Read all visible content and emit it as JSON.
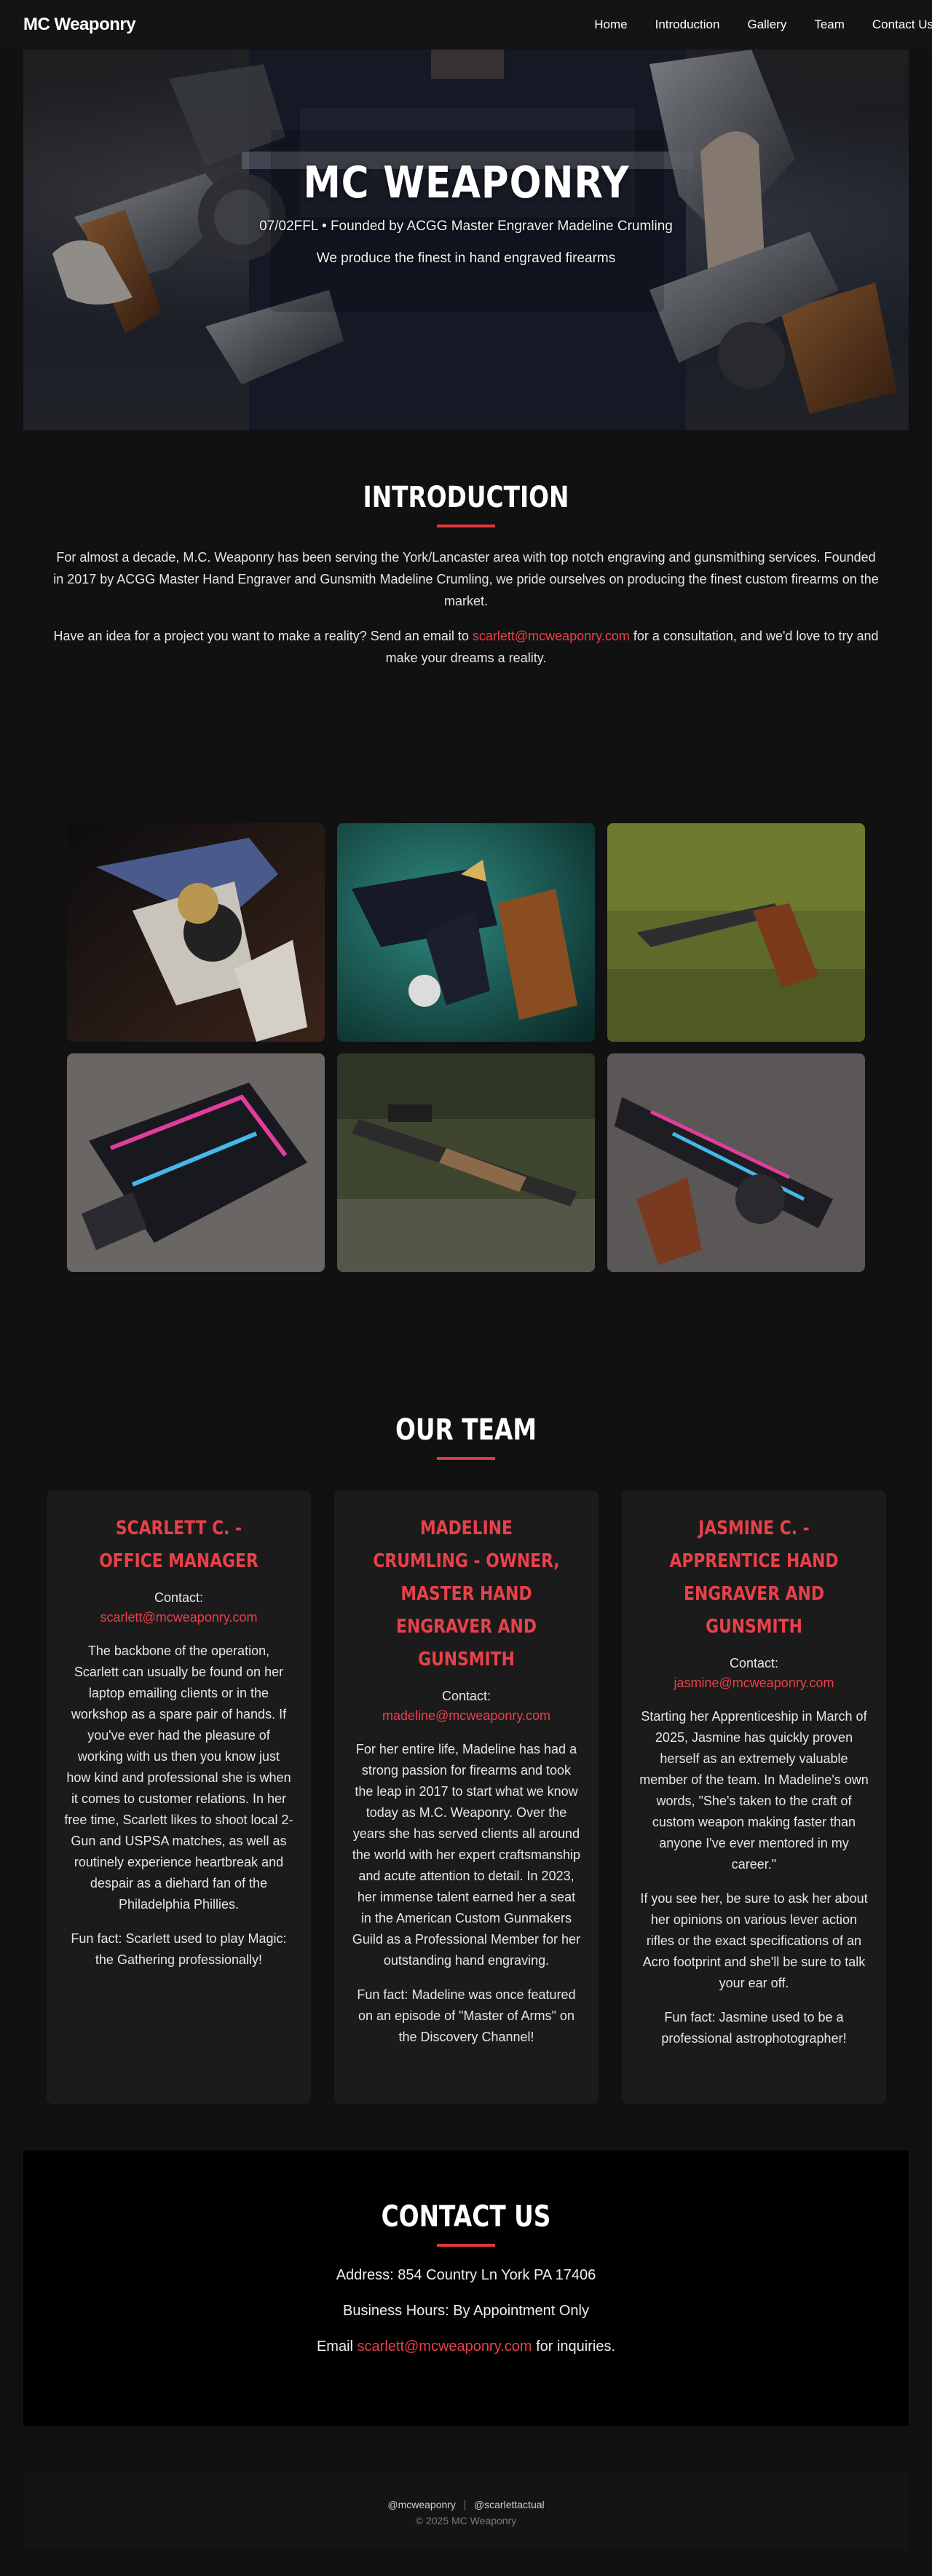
{
  "nav": {
    "brand": "MC Weaponry",
    "links": [
      "Home",
      "Introduction",
      "Gallery",
      "Team",
      "Contact Us"
    ]
  },
  "hero": {
    "title": "MC WEAPONRY",
    "subtitle": "07/02FFL • Founded by ACGG Master Engraver Madeline Crumling",
    "tagline": "We produce the finest in hand engraved firearms"
  },
  "intro": {
    "title": "INTRODUCTION",
    "p1": "For almost a decade, M.C. Weaponry has been serving the York/Lancaster area with top notch engraving and gunsmithing services. Founded in 2017 by ACGG Master Hand Engraver and Gunsmith Madeline Crumling, we pride ourselves on producing the finest custom firearms on the market.",
    "p2_before": "Have an idea for a project you want to make a reality? Send an email to ",
    "p2_email": "scarlett@mcweaponry.com",
    "p2_after": " for a consultation, and we'd love to try and make your dreams a reality."
  },
  "gallery": {
    "images": [
      "engraved-revolver-photo",
      "blued-revolver-photo",
      "pistol-on-moss-photo",
      "painted-p90-photo",
      "rifle-on-ground-photo",
      "painted-smg-photo"
    ]
  },
  "team": {
    "title": "OUR TEAM",
    "contact_label": "Contact:",
    "members": [
      {
        "name": "SCARLETT C. - OFFICE MANAGER",
        "email": "scarlett@mcweaponry.com",
        "paragraphs": [
          "The backbone of the operation, Scarlett can usually be found on her laptop emailing clients or in the workshop as a spare pair of hands. If you've ever had the pleasure of working with us then you know just how kind and professional she is when it comes to customer relations. In her free time, Scarlett likes to shoot local 2-Gun and USPSA matches, as well as routinely experience heartbreak and despair as a diehard fan of the Philadelphia Phillies.",
          "Fun fact: Scarlett used to play Magic: the Gathering professionally!"
        ]
      },
      {
        "name": "MADELINE CRUMLING - OWNER, MASTER HAND ENGRAVER AND GUNSMITH",
        "email": "madeline@mcweaponry.com",
        "paragraphs": [
          "For her entire life, Madeline has had a strong passion for firearms and took the leap in 2017 to start what we know today as M.C. Weaponry. Over the years she has served clients all around the world with her expert craftsmanship and acute attention to detail. In 2023, her immense talent earned her a seat in the American Custom Gunmakers Guild as a Professional Member for her outstanding hand engraving.",
          "Fun fact: Madeline was once featured on an episode of \"Master of Arms\" on the Discovery Channel!"
        ]
      },
      {
        "name": "JASMINE C. - APPRENTICE HAND ENGRAVER AND GUNSMITH",
        "email": "jasmine@mcweaponry.com",
        "paragraphs": [
          "Starting her Apprenticeship in March of 2025, Jasmine has quickly proven herself as an extremely valuable member of the team. In Madeline's own words, \"She's taken to the craft of custom weapon making faster than anyone I've ever mentored in my career.\"",
          "If you see her, be sure to ask her about her opinions on various lever action rifles or the exact specifications of an Acro footprint and she'll be sure to talk your ear off.",
          "Fun fact: Jasmine used to be a professional astrophotographer!"
        ]
      }
    ]
  },
  "contact": {
    "title": "CONTACT US",
    "address": "Address: 854 Country Ln York PA 17406",
    "hours": "Business Hours: By Appointment Only",
    "email_before": "Email ",
    "email": "scarlett@mcweaponry.com",
    "email_after": " for inquiries."
  },
  "footer": {
    "social1": "@mcweaponry",
    "social2": "@scarlettactual",
    "copyright": "© 2025 MC Weaponry"
  },
  "colors": {
    "accent": "#e8414a",
    "background": "#111111",
    "card": "#1b1b1b"
  }
}
